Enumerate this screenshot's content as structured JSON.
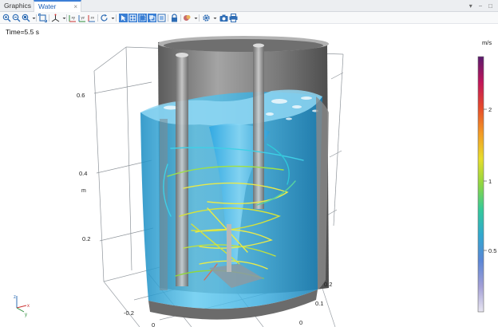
{
  "tabs": [
    {
      "label": "Graphics",
      "active": false
    },
    {
      "label": "Water Surface",
      "active": true
    }
  ],
  "tab_close_glyph": "×",
  "window_controls": "▾ ⎯ □",
  "toolbar": {
    "icons": [
      "zoom-in-icon",
      "zoom-out-icon",
      "zoom-box-icon",
      "dropdown-arrow-icon",
      "zoom-extents-icon",
      "axis-orientation-icon",
      "dropdown-arrow-icon",
      "xy-view-icon",
      "yz-view-icon",
      "zx-view-icon",
      "rotate-view-icon",
      "dropdown-arrow-icon",
      "select-box-icon",
      "grid-icon",
      "wireframe-icon",
      "transparency-icon",
      "show-hidden-icon",
      "lock-icon",
      "light-scene-icon",
      "dropdown-arrow-icon",
      "settings-icon",
      "dropdown-arrow-icon",
      "camera-icon",
      "print-icon"
    ]
  },
  "viewport": {
    "time_label": "Time=5.5 s",
    "z_axis": {
      "unit": "m",
      "ticks": [
        "0.6",
        "0.4",
        "0.2"
      ]
    },
    "x_axis": {
      "ticks": [
        "-0.2",
        "0"
      ]
    },
    "y_axis": {
      "ticks": [
        "0.2",
        "0.1",
        "0"
      ]
    },
    "colorbar": {
      "unit": "m/s",
      "ticks": [
        "2",
        "1",
        "0.5"
      ],
      "colors": [
        "#5a1a6e",
        "#c0155a",
        "#e64a2a",
        "#f39a25",
        "#e7dd2b",
        "#8fd641",
        "#34c99a",
        "#31a8cf",
        "#5b86d6",
        "#a39fd6",
        "#e8e6f1"
      ]
    },
    "colors": {
      "water": "#3fb4e6",
      "tank_wall": "#8e8e8e",
      "streamline_yellow": "#e8ea4a",
      "streamline_cyan": "#3ed0e6"
    }
  }
}
